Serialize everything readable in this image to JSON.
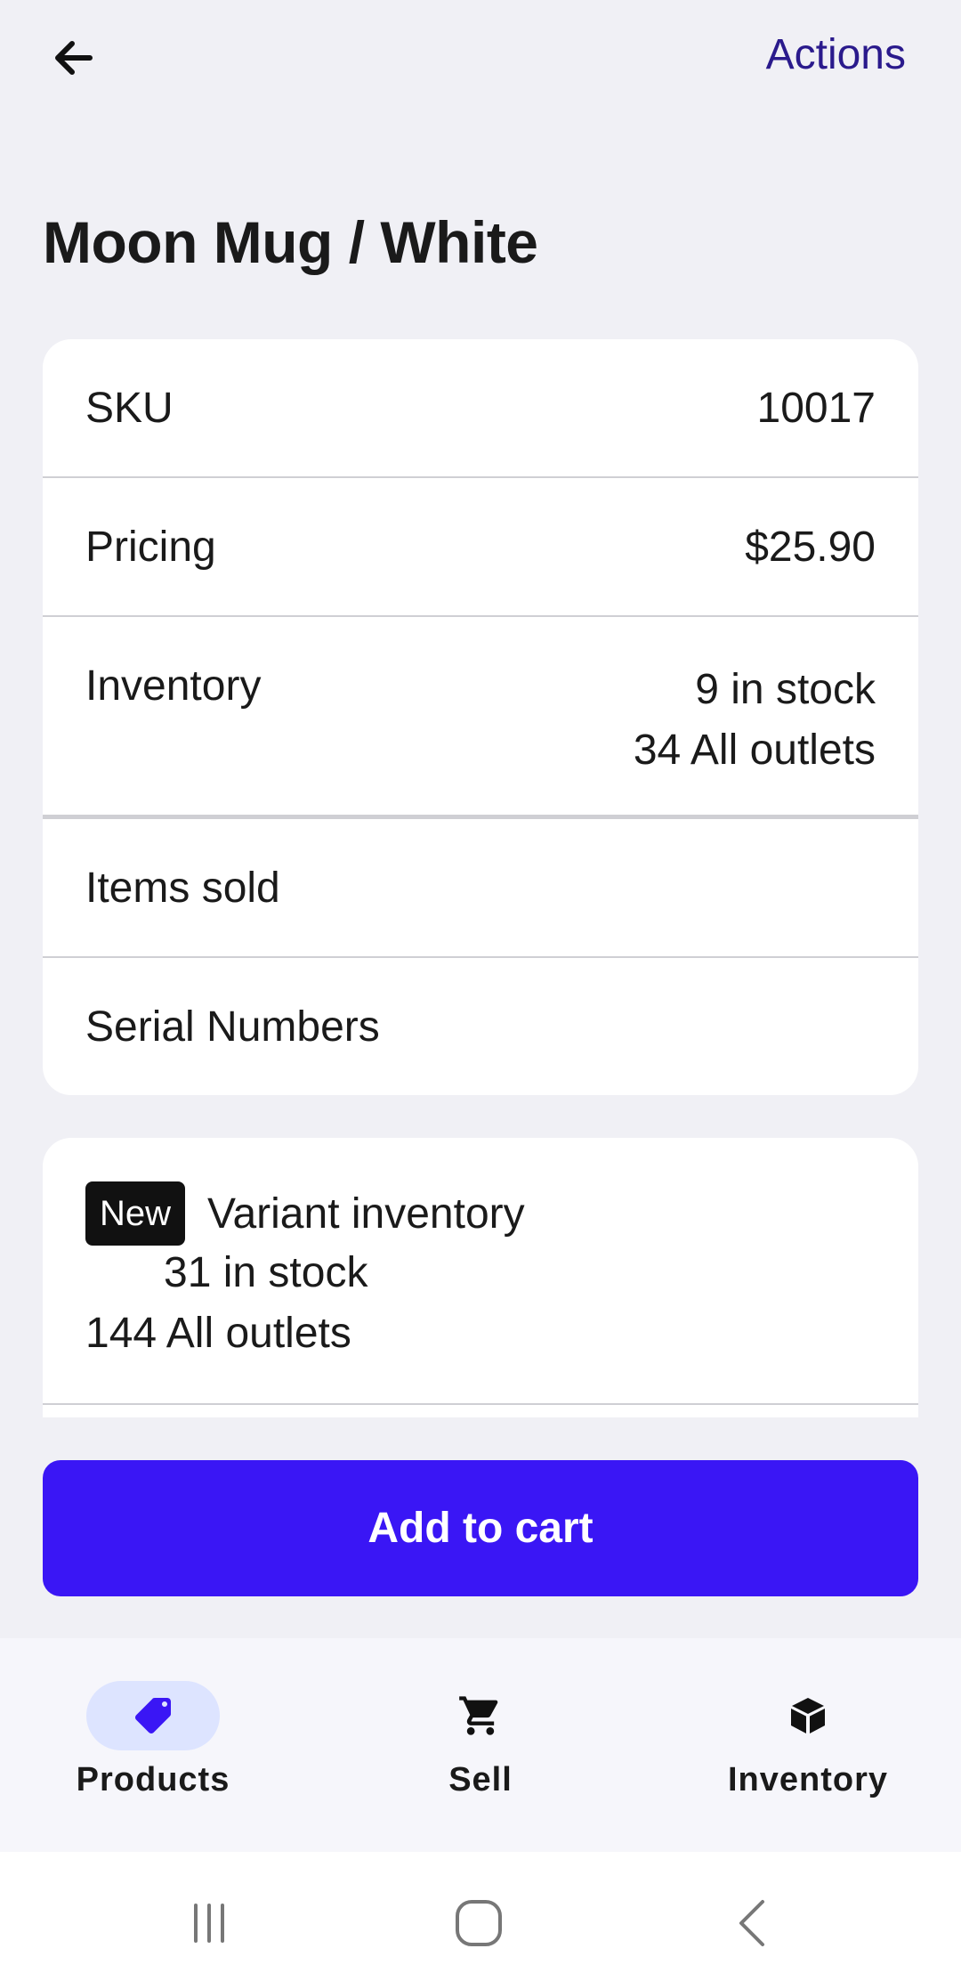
{
  "header": {
    "back_icon": "arrow-left-icon",
    "actions_label": "Actions",
    "title": "Moon Mug / White"
  },
  "details": {
    "sku_label": "SKU",
    "sku_value": "10017",
    "pricing_label": "Pricing",
    "pricing_value": "$25.90",
    "inventory_label": "Inventory",
    "inventory_stock": "9 in stock",
    "inventory_outlets": "34 All outlets",
    "items_sold_label": "Items sold",
    "serial_numbers_label": "Serial Numbers"
  },
  "variant": {
    "badge": "New",
    "title": "Variant inventory",
    "stock": "31 in stock",
    "outlets": "144 All outlets"
  },
  "cta": {
    "add_to_cart_label": "Add to cart"
  },
  "bottom_nav": {
    "items": [
      {
        "label": "Products",
        "icon": "tag-icon",
        "active": true
      },
      {
        "label": "Sell",
        "icon": "cart-icon",
        "active": false
      },
      {
        "label": "Inventory",
        "icon": "box-icon",
        "active": false
      }
    ]
  },
  "colors": {
    "accent": "#3a16f5",
    "actions_link": "#2a1a8c",
    "background": "#f0f0f5",
    "active_nav_pill": "#dde4ff"
  }
}
